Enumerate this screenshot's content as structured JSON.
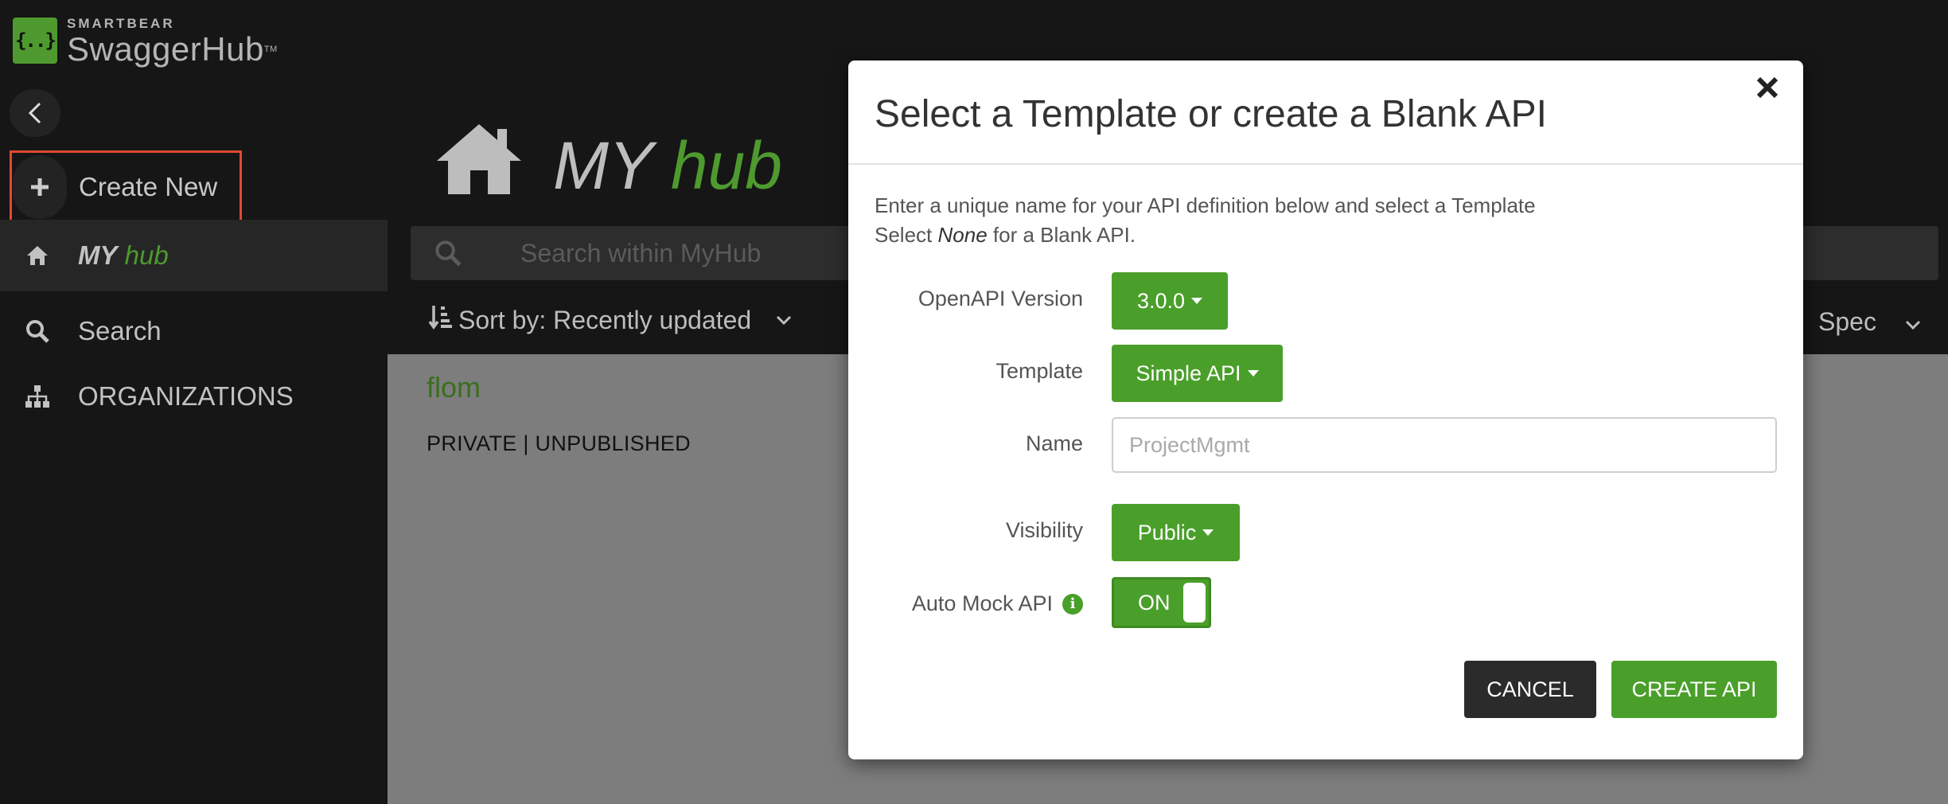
{
  "app": {
    "brand_small": "SMARTBEAR",
    "brand_name": "SwaggerHub",
    "brand_tm": "TM"
  },
  "sidebar": {
    "create_new_label": "Create New",
    "items": [
      {
        "my": "MY",
        "hub": "hub"
      },
      {
        "label": "Search"
      },
      {
        "label": "ORGANIZATIONS"
      }
    ]
  },
  "header": {
    "title_my": "MY",
    "title_hub": "hub"
  },
  "search": {
    "placeholder": "Search within MyHub"
  },
  "sort": {
    "label": "Sort by: Recently updated",
    "spec_label": "Spec"
  },
  "api_list": [
    {
      "name": "flom",
      "status": "PRIVATE | UNPUBLISHED"
    }
  ],
  "modal": {
    "title": "Select a Template or create a Blank API",
    "intro_line1": "Enter a unique name for your API definition below and select a Template",
    "intro_select": "Select",
    "intro_none": "None",
    "intro_rest": "for a Blank API.",
    "openapi_label": "OpenAPI Version",
    "openapi_value": "3.0.0",
    "template_label": "Template",
    "template_value": "Simple API",
    "name_label": "Name",
    "name_placeholder": "ProjectMgmt",
    "visibility_label": "Visibility",
    "visibility_value": "Public",
    "automock_label": "Auto Mock API",
    "automock_state": "ON",
    "cancel_label": "CANCEL",
    "create_label": "CREATE API"
  },
  "colors": {
    "accent_green": "#4a9f2a",
    "highlight_border": "#e04a2f",
    "sidebar_bg": "#161616",
    "content_bg": "#7d7d7d"
  }
}
